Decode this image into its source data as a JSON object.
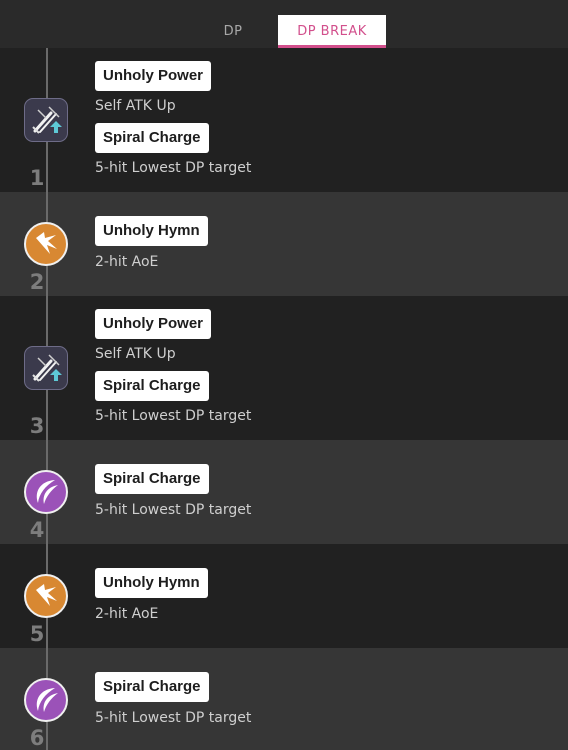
{
  "tabs": [
    {
      "label": "DP"
    },
    {
      "label": "DP BREAK"
    }
  ],
  "rows": [
    {
      "number": "1",
      "icon": "sword-buff-icon",
      "skills": [
        {
          "name": "Unholy Power",
          "desc": "Self ATK Up"
        },
        {
          "name": "Spiral Charge",
          "desc": "5-hit Lowest DP target"
        }
      ]
    },
    {
      "number": "2",
      "icon": "claw-burst-icon",
      "skills": [
        {
          "name": "Unholy Hymn",
          "desc": "2-hit AoE"
        }
      ]
    },
    {
      "number": "3",
      "icon": "sword-buff-icon",
      "skills": [
        {
          "name": "Unholy Power",
          "desc": "Self ATK Up"
        },
        {
          "name": "Spiral Charge",
          "desc": "5-hit Lowest DP target"
        }
      ]
    },
    {
      "number": "4",
      "icon": "crescent-slash-icon",
      "skills": [
        {
          "name": "Spiral Charge",
          "desc": "5-hit Lowest DP target"
        }
      ]
    },
    {
      "number": "5",
      "icon": "claw-burst-icon",
      "skills": [
        {
          "name": "Unholy Hymn",
          "desc": "2-hit AoE"
        }
      ]
    },
    {
      "number": "6",
      "icon": "crescent-slash-icon",
      "skills": [
        {
          "name": "Spiral Charge",
          "desc": "5-hit Lowest DP target"
        }
      ]
    }
  ],
  "colors": {
    "accent": "#d24f8c",
    "row_dark": "#212121",
    "row_light": "#363636",
    "icon_orange": "#d88832",
    "icon_purple": "#9b52b8",
    "icon_buff_bg": "#3b3a4c"
  }
}
